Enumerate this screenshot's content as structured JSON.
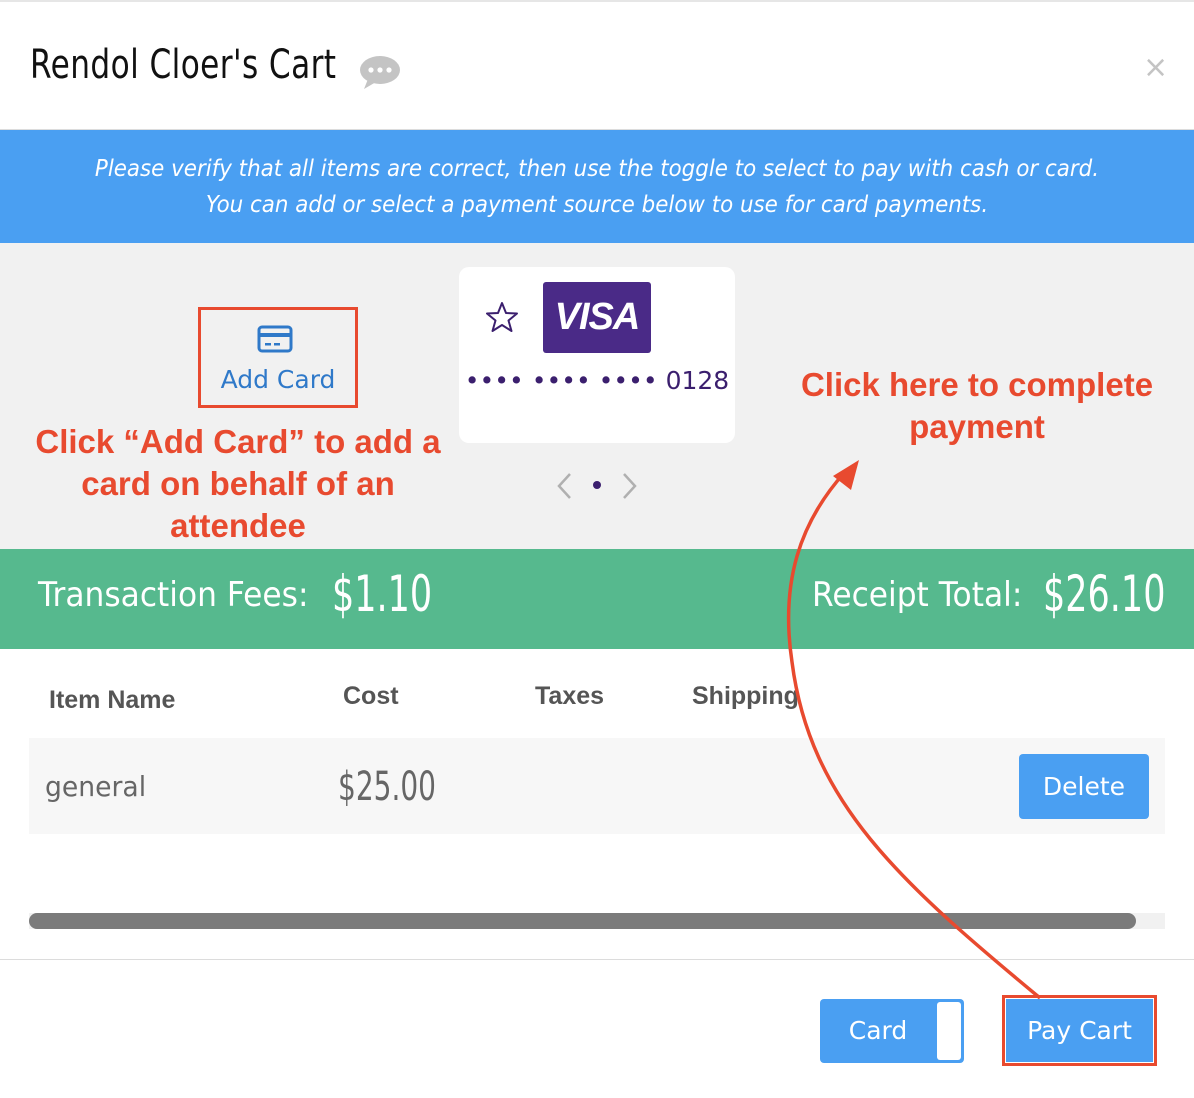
{
  "header": {
    "title": "Rendol Cloer's Cart",
    "close_symbol": "×"
  },
  "banner": {
    "line1": "Please verify that all items are correct, then use the toggle to select to pay with cash or card.",
    "line2": "You can add or select a payment source below to use for card payments."
  },
  "payment": {
    "add_card_label": "Add Card",
    "card": {
      "brand": "VISA",
      "number": "•••• •••• •••• 0128"
    }
  },
  "annotations": {
    "add_card": "Click “Add Card” to add a card on behalf of an attendee",
    "pay": "Click here to complete payment"
  },
  "totals": {
    "fees_label": "Transaction Fees:",
    "fees_value": "$1.10",
    "total_label": "Receipt Total:",
    "total_value": "$26.10"
  },
  "table": {
    "headers": {
      "name": "Item Name",
      "cost": "Cost",
      "taxes": "Taxes",
      "shipping": "Shipping"
    },
    "rows": [
      {
        "name": "general",
        "cost": "$25.00",
        "delete_label": "Delete"
      }
    ]
  },
  "footer": {
    "toggle_label": "Card",
    "pay_label": "Pay Cart"
  },
  "colors": {
    "accent_blue": "#4a9ff2",
    "success_green": "#56b98e",
    "annotation_red": "#e84a2f",
    "visa_purple": "#4a2a87"
  },
  "icons": [
    "chat-icon",
    "close-icon",
    "credit-card-icon",
    "star-icon",
    "chevron-left-icon",
    "chevron-right-icon"
  ]
}
